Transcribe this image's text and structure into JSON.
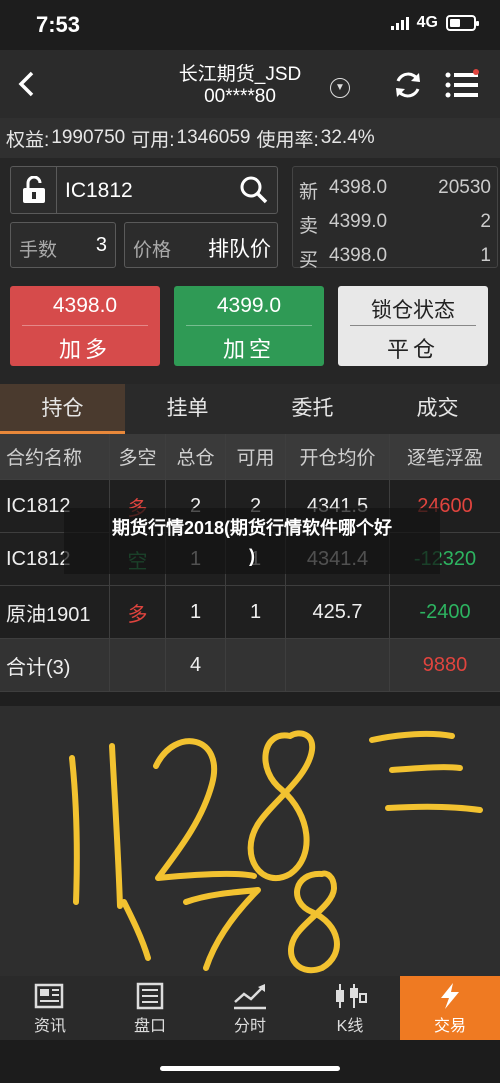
{
  "status_bar": {
    "time": "7:53",
    "network": "4G"
  },
  "header": {
    "title_line1": "长江期货_JSD",
    "title_line2": "00****80"
  },
  "equity": {
    "equity_label": "权益:",
    "equity_value": "1990750",
    "available_label": "可用:",
    "available_value": "1346059",
    "usage_label": "使用率:",
    "usage_value": "32.4%"
  },
  "order": {
    "code": "IC1812",
    "qty_label": "手数",
    "qty_value": "3",
    "price_label": "价格",
    "price_value": "排队价"
  },
  "quote": {
    "new_label": "新",
    "new_price": "4398.0",
    "new_vol": "20530",
    "sell_label": "卖",
    "sell_price": "4399.0",
    "sell_vol": "2",
    "buy_label": "买",
    "buy_price": "4398.0",
    "buy_vol": "1"
  },
  "actions": {
    "long_price": "4398.0",
    "long_label": "加多",
    "short_price": "4399.0",
    "short_label": "加空",
    "lock_label": "锁仓状态",
    "close_label": "平仓"
  },
  "tabs": [
    "持仓",
    "挂单",
    "委托",
    "成交"
  ],
  "positions": {
    "headers": [
      "合约名称",
      "多空",
      "总仓",
      "可用",
      "开仓均价",
      "逐笔浮盈"
    ],
    "rows": [
      {
        "name": "IC1812",
        "side": "多",
        "total": "2",
        "avail": "2",
        "avg": "4341.5",
        "pnl": "24600"
      },
      {
        "name": "IC1812",
        "side": "空",
        "total": "1",
        "avail": "1",
        "avg": "4341.4",
        "pnl": "-12320"
      },
      {
        "name": "原油1901",
        "side": "多",
        "total": "1",
        "avail": "1",
        "avg": "425.7",
        "pnl": "-2400"
      }
    ],
    "total": {
      "label": "合计(3)",
      "total": "4",
      "pnl": "9880"
    }
  },
  "overlay": {
    "line1": "期货行情2018(期货行情软件哪个好",
    "line2": ")"
  },
  "handwriting": "1128 = 178",
  "bottom_nav": [
    "资讯",
    "盘口",
    "分时",
    "K线",
    "交易"
  ],
  "colors": {
    "long": "#d64b4b",
    "short": "#2f9a55",
    "accent": "#ef7a22",
    "ink": "#f2c230"
  }
}
